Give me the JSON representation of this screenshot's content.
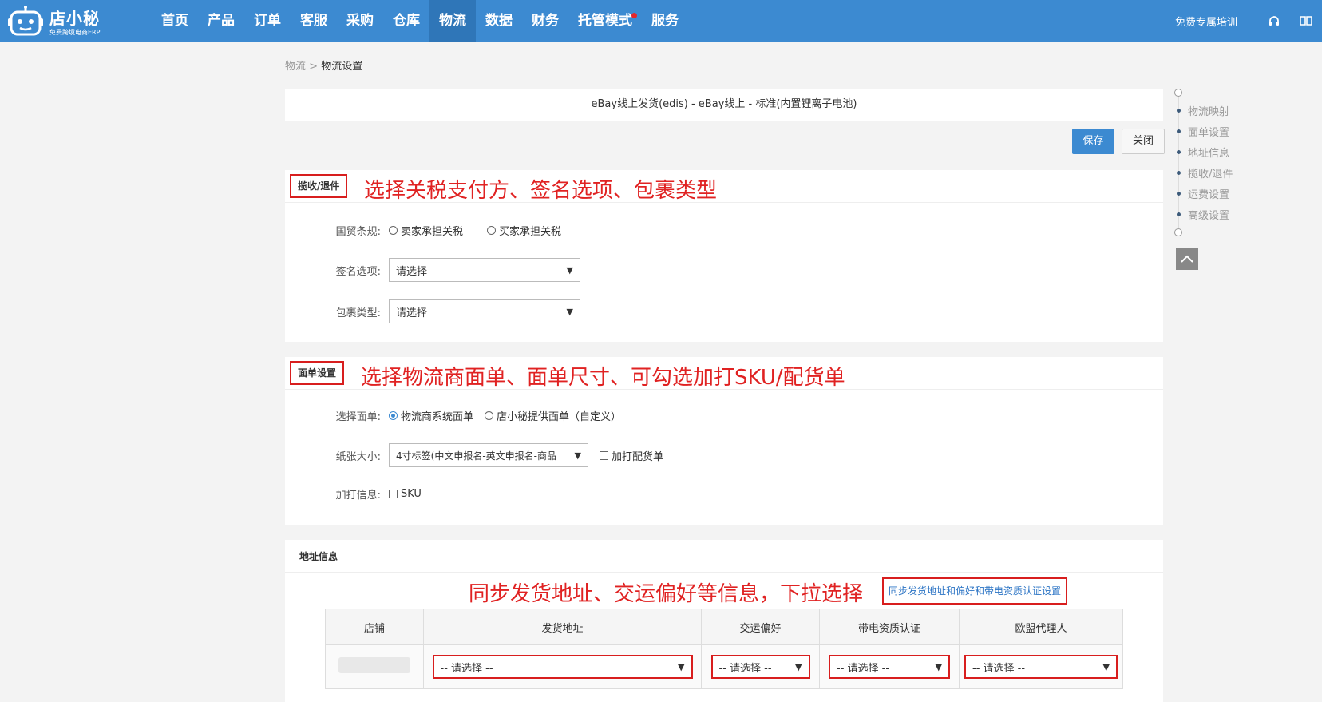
{
  "header": {
    "brand": "店小秘",
    "tagline": "免费跨境电商ERP",
    "nav": [
      {
        "label": "首页"
      },
      {
        "label": "产品"
      },
      {
        "label": "订单"
      },
      {
        "label": "客服"
      },
      {
        "label": "采购"
      },
      {
        "label": "仓库"
      },
      {
        "label": "物流",
        "active": true
      },
      {
        "label": "数据"
      },
      {
        "label": "财务"
      },
      {
        "label": "托管模式",
        "badge": true
      },
      {
        "label": "服务"
      }
    ],
    "training": "免费专属培训",
    "icons": [
      "headset-icon",
      "book-icon"
    ]
  },
  "breadcrumb": {
    "parent": "物流",
    "separator": ">",
    "current": "物流设置"
  },
  "title": "eBay线上发货(edis) - eBay线上  -  标准(内置锂离子电池)",
  "actions": {
    "save": "保存",
    "close": "关闭"
  },
  "pickup": {
    "title": "揽收/退件",
    "note": "选择关税支付方、签名选项、包裹类型",
    "incoterm_label": "国贸条规:",
    "incoterm_options": [
      "卖家承担关税",
      "买家承担关税"
    ],
    "signature_label": "签名选项:",
    "signature_value": "请选择",
    "package_label": "包裹类型:",
    "package_value": "请选择"
  },
  "label_settings": {
    "title": "面单设置",
    "note": "选择物流商面单、面单尺寸、可勾选加打SKU/配货单",
    "choose_label": "选择面单:",
    "choose_options": [
      "物流商系统面单",
      "店小秘提供面单（自定义）"
    ],
    "paper_label": "纸张大小:",
    "paper_value": "4寸标签(中文申报名-英文申报名-商品",
    "picking_list": "加打配货单",
    "extra_label": "加打信息:",
    "extra_sku": "SKU"
  },
  "address": {
    "title": "地址信息",
    "note": "同步发货地址、交运偏好等信息，下拉选择",
    "sync_link": "同步发货地址和偏好和带电资质认证设置",
    "columns": [
      "店铺",
      "发货地址",
      "交运偏好",
      "带电资质认证",
      "欧盟代理人"
    ],
    "placeholder": "-- 请选择 --"
  },
  "side_nav": {
    "items": [
      "物流映射",
      "面单设置",
      "地址信息",
      "揽收/退件",
      "运费设置",
      "高级设置"
    ]
  },
  "colors": {
    "primary": "#3c8ad1",
    "annotation": "#e02222"
  }
}
